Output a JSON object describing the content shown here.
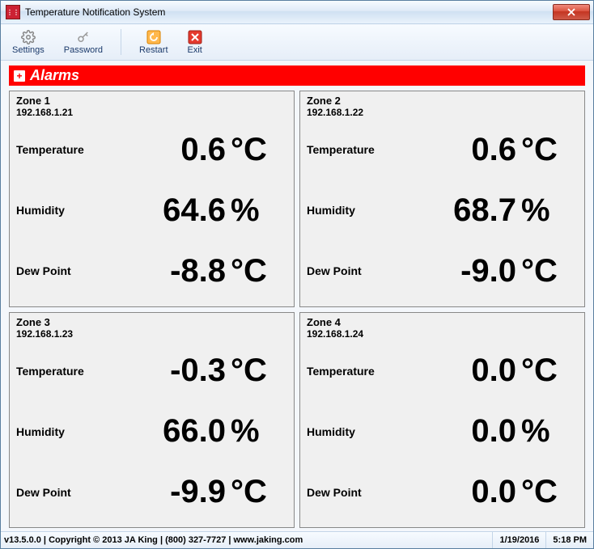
{
  "window": {
    "title": "Temperature Notification System"
  },
  "toolbar": {
    "settings": "Settings",
    "password": "Password",
    "restart": "Restart",
    "exit": "Exit"
  },
  "alarms": {
    "label": "Alarms"
  },
  "labels": {
    "temperature": "Temperature",
    "humidity": "Humidity",
    "dewpoint": "Dew Point"
  },
  "units": {
    "celsius": "°C",
    "percent": "%"
  },
  "zones": [
    {
      "name": "Zone 1",
      "ip": "192.168.1.21",
      "temperature": "0.6",
      "humidity": "64.6",
      "dewpoint": "-8.8"
    },
    {
      "name": "Zone 2",
      "ip": "192.168.1.22",
      "temperature": "0.6",
      "humidity": "68.7",
      "dewpoint": "-9.0"
    },
    {
      "name": "Zone 3",
      "ip": "192.168.1.23",
      "temperature": "-0.3",
      "humidity": "66.0",
      "dewpoint": "-9.9"
    },
    {
      "name": "Zone 4",
      "ip": "192.168.1.24",
      "temperature": "0.0",
      "humidity": "0.0",
      "dewpoint": "0.0"
    }
  ],
  "status": {
    "left": "v13.5.0.0 | Copyright ©  2013 JA King | (800) 327-7727 | www.jaking.com",
    "date": "1/19/2016",
    "time": "5:18 PM"
  }
}
